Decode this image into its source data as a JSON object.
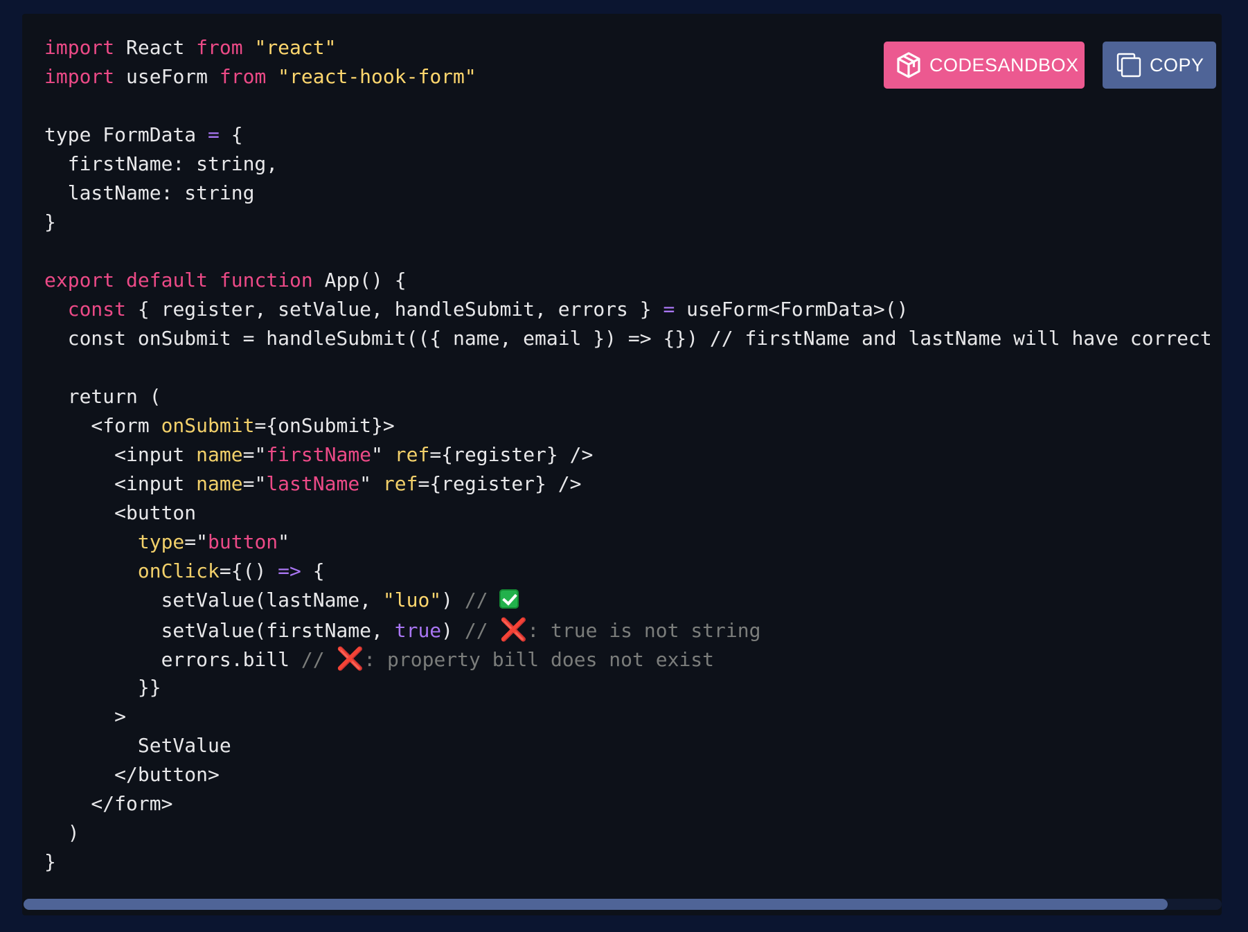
{
  "toolbar": {
    "codesandbox_label": "CODESANDBOX",
    "copy_label": "COPY",
    "codesandbox_icon": "cube-icon",
    "copy_icon": "copy-icon",
    "codesandbox_color": "#ec5990",
    "copy_color": "#4f6497"
  },
  "code": {
    "language": "tsx",
    "lines": [
      [
        {
          "t": "import",
          "c": "kw"
        },
        {
          "t": " React ",
          "c": "pl"
        },
        {
          "t": "from",
          "c": "kw"
        },
        {
          "t": " ",
          "c": "pl"
        },
        {
          "t": "\"react\"",
          "c": "str"
        }
      ],
      [
        {
          "t": "import",
          "c": "kw"
        },
        {
          "t": " useForm ",
          "c": "pl"
        },
        {
          "t": "from",
          "c": "kw"
        },
        {
          "t": " ",
          "c": "pl"
        },
        {
          "t": "\"react-hook-form\"",
          "c": "str"
        }
      ],
      [],
      [
        {
          "t": "type FormData ",
          "c": "pl"
        },
        {
          "t": "=",
          "c": "op"
        },
        {
          "t": " {",
          "c": "pl"
        }
      ],
      [
        {
          "t": "  firstName: string,",
          "c": "pl"
        }
      ],
      [
        {
          "t": "  lastName: string",
          "c": "pl"
        }
      ],
      [
        {
          "t": "}",
          "c": "pl"
        }
      ],
      [],
      [
        {
          "t": "export",
          "c": "kw"
        },
        {
          "t": " ",
          "c": "pl"
        },
        {
          "t": "default",
          "c": "kw"
        },
        {
          "t": " ",
          "c": "pl"
        },
        {
          "t": "function",
          "c": "kw"
        },
        {
          "t": " App() {",
          "c": "pl"
        }
      ],
      [
        {
          "t": "  ",
          "c": "pl"
        },
        {
          "t": "const",
          "c": "kw"
        },
        {
          "t": " { register, setValue, handleSubmit, errors } ",
          "c": "pl"
        },
        {
          "t": "=",
          "c": "op"
        },
        {
          "t": " useForm<FormData>()",
          "c": "pl"
        }
      ],
      [
        {
          "t": "  const onSubmit = handleSubmit(({ name, email }) => {}) // firstName and lastName will have correct type",
          "c": "pl"
        }
      ],
      [],
      [
        {
          "t": "  return (",
          "c": "pl"
        }
      ],
      [
        {
          "t": "    <form ",
          "c": "pl"
        },
        {
          "t": "onSubmit",
          "c": "attr"
        },
        {
          "t": "={onSubmit}>",
          "c": "pl"
        }
      ],
      [
        {
          "t": "      <input ",
          "c": "pl"
        },
        {
          "t": "name",
          "c": "attr"
        },
        {
          "t": "=\"",
          "c": "pl"
        },
        {
          "t": "firstName",
          "c": "attrv"
        },
        {
          "t": "\" ",
          "c": "pl"
        },
        {
          "t": "ref",
          "c": "attr"
        },
        {
          "t": "={register} />",
          "c": "pl"
        }
      ],
      [
        {
          "t": "      <input ",
          "c": "pl"
        },
        {
          "t": "name",
          "c": "attr"
        },
        {
          "t": "=\"",
          "c": "pl"
        },
        {
          "t": "lastName",
          "c": "attrv"
        },
        {
          "t": "\" ",
          "c": "pl"
        },
        {
          "t": "ref",
          "c": "attr"
        },
        {
          "t": "={register} />",
          "c": "pl"
        }
      ],
      [
        {
          "t": "      <button",
          "c": "pl"
        }
      ],
      [
        {
          "t": "        ",
          "c": "pl"
        },
        {
          "t": "type",
          "c": "attr"
        },
        {
          "t": "=\"",
          "c": "pl"
        },
        {
          "t": "button",
          "c": "attrv"
        },
        {
          "t": "\"",
          "c": "pl"
        }
      ],
      [
        {
          "t": "        ",
          "c": "pl"
        },
        {
          "t": "onClick",
          "c": "attr"
        },
        {
          "t": "={() ",
          "c": "pl"
        },
        {
          "t": "=>",
          "c": "op"
        },
        {
          "t": " {",
          "c": "pl"
        }
      ],
      [
        {
          "t": "          setValue(lastName, ",
          "c": "pl"
        },
        {
          "t": "\"luo\"",
          "c": "str"
        },
        {
          "t": ") ",
          "c": "pl"
        },
        {
          "t": "// ",
          "c": "cmt"
        },
        {
          "t": "check",
          "c": "emoji-check"
        }
      ],
      [
        {
          "t": "          setValue(firstName, ",
          "c": "pl"
        },
        {
          "t": "true",
          "c": "bool"
        },
        {
          "t": ") ",
          "c": "pl"
        },
        {
          "t": "// ",
          "c": "cmt"
        },
        {
          "t": "❌",
          "c": "emoji-x"
        },
        {
          "t": ": true is not string",
          "c": "cmt"
        }
      ],
      [
        {
          "t": "          errors.bill ",
          "c": "pl"
        },
        {
          "t": "// ",
          "c": "cmt"
        },
        {
          "t": "❌",
          "c": "emoji-x"
        },
        {
          "t": ": property bill does not exist",
          "c": "cmt"
        }
      ],
      [
        {
          "t": "        }}",
          "c": "pl"
        }
      ],
      [
        {
          "t": "      >",
          "c": "pl"
        }
      ],
      [
        {
          "t": "        SetValue",
          "c": "pl"
        }
      ],
      [
        {
          "t": "      </button>",
          "c": "pl"
        }
      ],
      [
        {
          "t": "    </form>",
          "c": "pl"
        }
      ],
      [
        {
          "t": "  )",
          "c": "pl"
        }
      ],
      [
        {
          "t": "}",
          "c": "pl"
        }
      ]
    ]
  },
  "scrollbar": {
    "position_fraction": 0.0,
    "visible_fraction": 0.955
  }
}
